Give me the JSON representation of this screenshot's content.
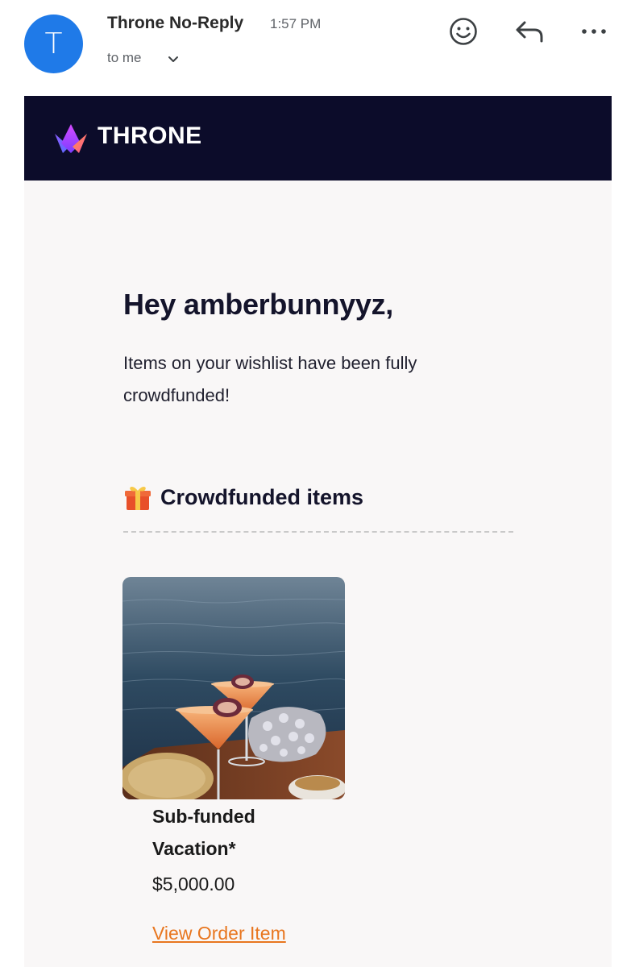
{
  "email": {
    "sender_initial": "T",
    "sender_name": "Throne No-Reply",
    "time": "1:57 PM",
    "recipient": "to me"
  },
  "header_icons": [
    "emoji-icon",
    "reply-icon",
    "more-icon"
  ],
  "brand": {
    "name": "THRONE",
    "banner_color": "#0c0c2a"
  },
  "body": {
    "greeting": "Hey amberbunnyyz,",
    "intro": "Items on your wishlist have been fully crowdfunded!",
    "section_title": "Crowdfunded items",
    "section_icon": "gift-icon"
  },
  "items": [
    {
      "title": "Sub-funded Vacation*",
      "price": "$5,000.00",
      "link_label": "View Order Item",
      "link_color": "#e8761f"
    }
  ]
}
